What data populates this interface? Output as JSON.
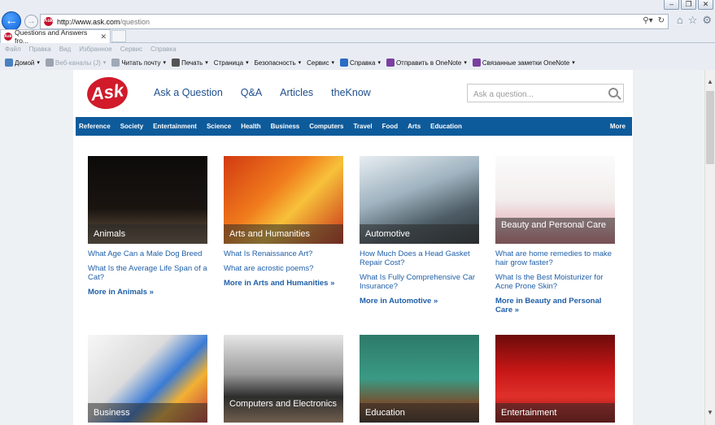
{
  "browser": {
    "url_host": "http://www.ask.com",
    "url_path": "/question",
    "tab_title": "Questions and Answers fro...",
    "favicon_text": "Ask",
    "window_buttons": [
      "–",
      "❐",
      "✕"
    ],
    "menu": [
      "Файл",
      "Правка",
      "Вид",
      "Избранное",
      "Сервис",
      "Справка"
    ],
    "commands": [
      {
        "label": "Домой",
        "dim": false,
        "icon_color": "#4a7fc1"
      },
      {
        "label": "Веб-каналы (J)",
        "dim": true,
        "icon_color": "#9aa3ae"
      },
      {
        "label": "Читать почту",
        "dim": false,
        "icon_color": "#9fa9b5"
      },
      {
        "label": "Печать",
        "dim": false,
        "icon_color": "#555"
      },
      {
        "label": "Страница",
        "dim": false,
        "icon_color": ""
      },
      {
        "label": "Безопасность",
        "dim": false,
        "icon_color": ""
      },
      {
        "label": "Сервис",
        "dim": false,
        "icon_color": ""
      },
      {
        "label": "Справка",
        "dim": false,
        "icon_color": "#2b6cc4"
      },
      {
        "label": "Отправить в OneNote",
        "dim": false,
        "icon_color": "#7b3fa0"
      },
      {
        "label": "Связанные заметки OneNote",
        "dim": false,
        "icon_color": "#7b3fa0"
      }
    ]
  },
  "site": {
    "logo_text": "Ask",
    "nav": [
      "Ask a Question",
      "Q&A",
      "Articles",
      "theKnow"
    ],
    "search_placeholder": "Ask a question...",
    "categories": [
      "Reference",
      "Society",
      "Entertainment",
      "Science",
      "Health",
      "Business",
      "Computers",
      "Travel",
      "Food",
      "Arts",
      "Education"
    ],
    "categories_more": "More",
    "cards": [
      {
        "title": "Animals",
        "links": [
          "What Age Can a Male Dog Breed",
          "What Is the Average Life Span of a Cat?"
        ],
        "more": "More in Animals »",
        "bg": "linear-gradient(#0c0b0a,#1a1411 60%,#6d5a44)"
      },
      {
        "title": "Arts and Humanities",
        "links": [
          "What Is Renaissance Art?",
          "What are acrostic poems?"
        ],
        "more": "More in Arts and Humanities »",
        "bg": "linear-gradient(135deg,#d23a12,#f07b1c 40%,#f7c13a 60%,#c9301a)"
      },
      {
        "title": "Automotive",
        "links": [
          "How Much Does a Head Gasket Repair Cost?",
          "What Is Fully Comprehensive Car Insurance?"
        ],
        "more": "More in Automotive »",
        "bg": "linear-gradient(160deg,#e8eef2,#9fb3c0 40%,#4e5d66 70%,#2b3238)"
      },
      {
        "title": "Beauty and Personal Care",
        "links": [
          "What are home remedies to make hair grow faster?",
          "What Is the Best Moisturizer for Acne Prone Skin?"
        ],
        "more": "More in Beauty and Personal Care »",
        "bg": "linear-gradient(#fbfbfb,#f2eded 50%,#e7b9be 80%,#d77f89)"
      },
      {
        "title": "Business",
        "links": [],
        "more": "",
        "bg": "linear-gradient(135deg,#f7f7f7,#dcdcdc 40%,#3a7bd5 60%,#f2b134 75%,#c23a3a)"
      },
      {
        "title": "Computers and Electronics",
        "links": [],
        "more": "",
        "bg": "linear-gradient(#e6e6e6,#9a9a9a 45%,#2f2f2f 70%,#c7a07d)"
      },
      {
        "title": "Education",
        "links": [],
        "more": "",
        "bg": "linear-gradient(#2d7a6a,#3a9a84 50%,#7b4a2a 80%,#3b2a1f)"
      },
      {
        "title": "Entertainment",
        "links": [],
        "more": "",
        "bg": "linear-gradient(#6d0b0b,#c51616 40%,#e0302b 70%,#8e0d0d)"
      }
    ]
  }
}
